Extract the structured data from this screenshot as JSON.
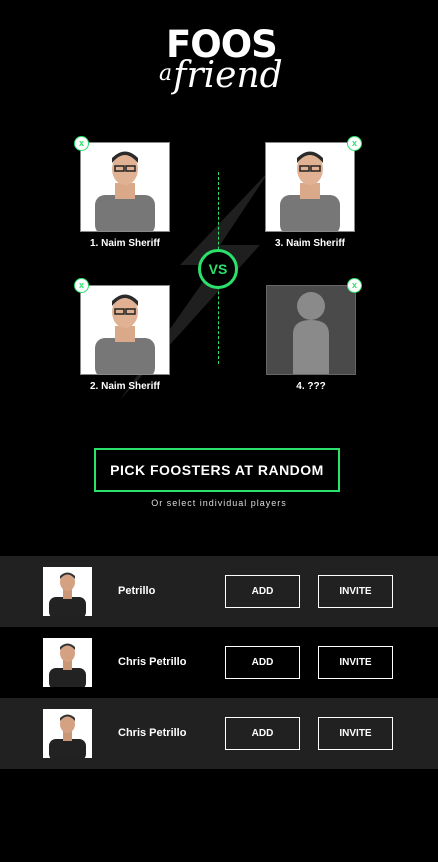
{
  "logo": {
    "top": "FOOS",
    "a": "a",
    "bottom": "friend"
  },
  "match": {
    "vs_label": "VS",
    "slots": [
      {
        "label": "1. Naim Sheriff",
        "remove": "x",
        "has_player": true
      },
      {
        "label": "2. Naim Sheriff",
        "remove": "x",
        "has_player": true
      },
      {
        "label": "3. Naim Sheriff",
        "remove": "x",
        "has_player": true
      },
      {
        "label": "4. ???",
        "remove": "x",
        "has_player": false
      }
    ]
  },
  "random_button": "PICK FOOSTERS AT RANDOM",
  "hint": "Or select individual players",
  "players": [
    {
      "name": "Petrillo",
      "add": "ADD",
      "invite": "INVITE"
    },
    {
      "name": "Chris Petrillo",
      "add": "ADD",
      "invite": "INVITE"
    },
    {
      "name": "Chris Petrillo",
      "add": "ADD",
      "invite": "INVITE"
    }
  ],
  "colors": {
    "accent": "#2be06b",
    "row_alt": "#212121",
    "background": "#000000"
  }
}
